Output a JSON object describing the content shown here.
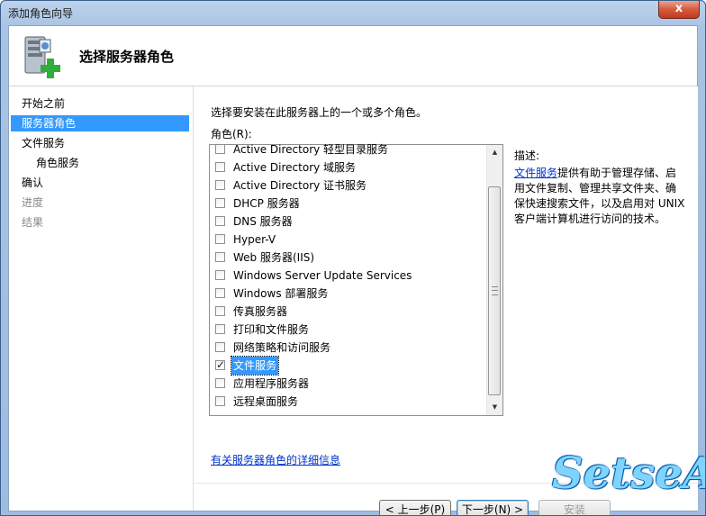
{
  "window": {
    "title": "添加角色向导",
    "close_label": "x"
  },
  "header": {
    "title": "选择服务器角色",
    "icon": "server-add-icon"
  },
  "nav": {
    "items": [
      {
        "label": "开始之前",
        "state": "normal"
      },
      {
        "label": "服务器角色",
        "state": "active"
      },
      {
        "label": "文件服务",
        "state": "normal"
      },
      {
        "label": "角色服务",
        "state": "sub"
      },
      {
        "label": "确认",
        "state": "normal"
      },
      {
        "label": "进度",
        "state": "disabled"
      },
      {
        "label": "结果",
        "state": "disabled"
      }
    ]
  },
  "main": {
    "instruction": "选择要安装在此服务器上的一个或多个角色。",
    "roles_label": "角色(R):",
    "roles": [
      {
        "label": "Active Directory 轻型目录服务",
        "checked": false
      },
      {
        "label": "Active Directory 域服务",
        "checked": false
      },
      {
        "label": "Active Directory 证书服务",
        "checked": false
      },
      {
        "label": "DHCP 服务器",
        "checked": false
      },
      {
        "label": "DNS 服务器",
        "checked": false
      },
      {
        "label": "Hyper-V",
        "checked": false
      },
      {
        "label": "Web 服务器(IIS)",
        "checked": false
      },
      {
        "label": "Windows Server Update Services",
        "checked": false
      },
      {
        "label": "Windows 部署服务",
        "checked": false
      },
      {
        "label": "传真服务器",
        "checked": false
      },
      {
        "label": "打印和文件服务",
        "checked": false
      },
      {
        "label": "网络策略和访问服务",
        "checked": false
      },
      {
        "label": "文件服务",
        "checked": true,
        "selected": true
      },
      {
        "label": "应用程序服务器",
        "checked": false
      },
      {
        "label": "远程桌面服务",
        "checked": false
      }
    ],
    "check_mark": "✓",
    "description_label": "描述:",
    "description_link": "文件服务",
    "description_text": "提供有助于管理存储、启用文件复制、管理共享文件夹、确保快速搜索文件，以及启用对 UNIX 客户端计算机进行访问的技术。",
    "more_info_link": "有关服务器角色的详细信息"
  },
  "buttons": {
    "back": "< 上一步(P)",
    "next": "下一步(N) >",
    "install": "安装"
  },
  "watermark": "SetseA",
  "colors": {
    "selection": "#3399ff",
    "link": "#0033cc"
  }
}
